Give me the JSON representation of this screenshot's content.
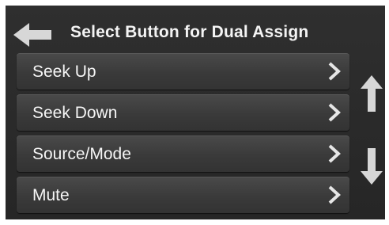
{
  "header": {
    "title": "Select Button for Dual Assign",
    "back_icon": "arrow-left-icon"
  },
  "menu": {
    "items": [
      {
        "label": "Seek Up",
        "icon": "chevron-right-icon"
      },
      {
        "label": "Seek Down",
        "icon": "chevron-right-icon"
      },
      {
        "label": "Source/Mode",
        "icon": "chevron-right-icon"
      },
      {
        "label": "Mute",
        "icon": "chevron-right-icon"
      }
    ]
  },
  "scroll": {
    "up_icon": "arrow-up-icon",
    "down_icon": "arrow-down-icon"
  },
  "colors": {
    "background": "#2b2b2b",
    "button": "#3d3d3d",
    "text": "#f5f5f5",
    "icon": "#d9d9d9"
  }
}
